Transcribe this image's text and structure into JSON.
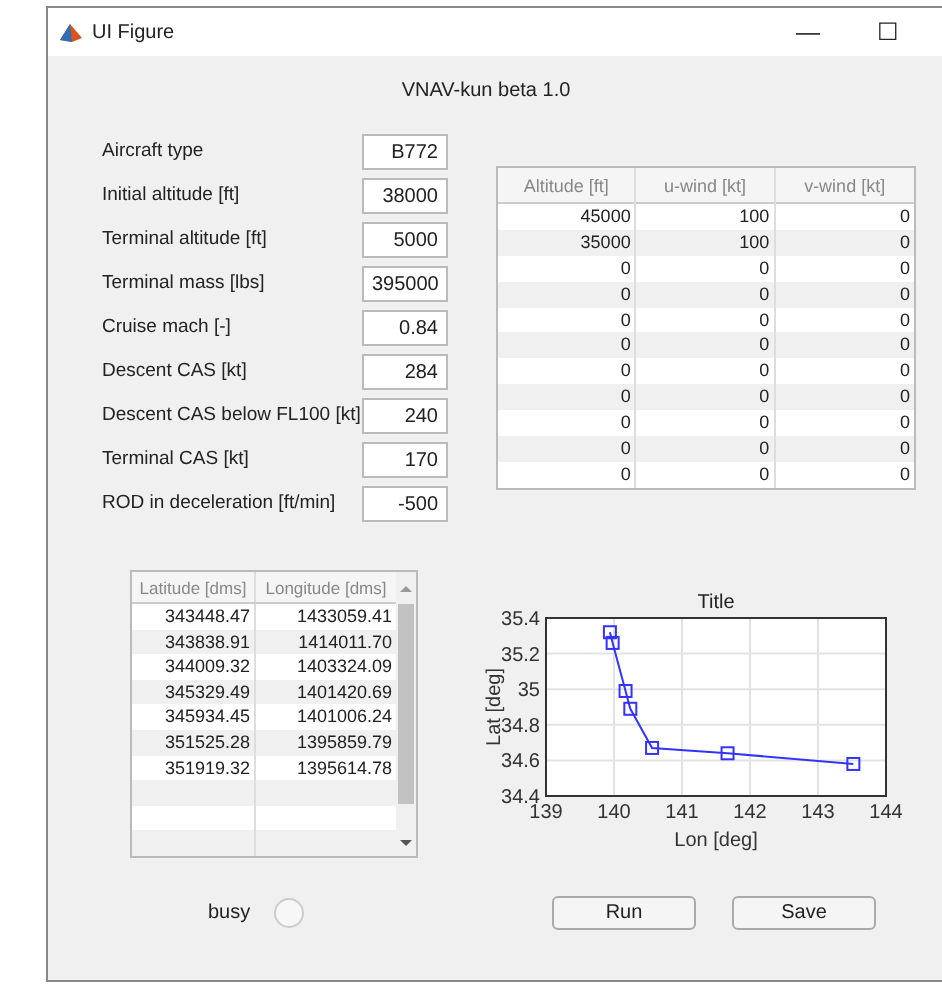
{
  "window": {
    "title": "UI Figure",
    "controls": [
      "—",
      "☐"
    ]
  },
  "header": "VNAV-kun beta 1.0",
  "form": [
    {
      "label": "Aircraft type",
      "value": "B772"
    },
    {
      "label": "Initial altitude [ft]",
      "value": "38000"
    },
    {
      "label": "Terminal altitude [ft]",
      "value": "5000"
    },
    {
      "label": "Terminal mass [lbs]",
      "value": "395000"
    },
    {
      "label": "Cruise mach [-]",
      "value": "0.84"
    },
    {
      "label": "Descent CAS [kt]",
      "value": "284"
    },
    {
      "label": "Descent CAS below FL100 [kt]",
      "value": "240"
    },
    {
      "label": "Terminal CAS [kt]",
      "value": "170"
    },
    {
      "label": "ROD in deceleration [ft/min]",
      "value": "-500"
    }
  ],
  "wind_table": {
    "columns": [
      "Altitude [ft]",
      "u-wind [kt]",
      "v-wind [kt]"
    ],
    "rows": [
      [
        "45000",
        "100",
        "0"
      ],
      [
        "35000",
        "100",
        "0"
      ],
      [
        "0",
        "0",
        "0"
      ],
      [
        "0",
        "0",
        "0"
      ],
      [
        "0",
        "0",
        "0"
      ],
      [
        "0",
        "0",
        "0"
      ],
      [
        "0",
        "0",
        "0"
      ],
      [
        "0",
        "0",
        "0"
      ],
      [
        "0",
        "0",
        "0"
      ],
      [
        "0",
        "0",
        "0"
      ],
      [
        "0",
        "0",
        "0"
      ]
    ]
  },
  "waypoint_table": {
    "columns": [
      "Latitude [dms]",
      "Longitude [dms]"
    ],
    "rows": [
      [
        "343448.47",
        "1433059.41"
      ],
      [
        "343838.91",
        "1414011.70"
      ],
      [
        "344009.32",
        "1403324.09"
      ],
      [
        "345329.49",
        "1401420.69"
      ],
      [
        "345934.45",
        "1401006.24"
      ],
      [
        "351525.28",
        "1395859.79"
      ],
      [
        "351919.32",
        "1395614.78"
      ]
    ]
  },
  "busy": {
    "label": "busy",
    "on": false
  },
  "chart": {
    "chart_data": {
      "type": "line",
      "title": "Title",
      "xlabel": "Lon [deg]",
      "ylabel": "Lat [deg]",
      "x": [
        143.52,
        141.67,
        140.56,
        140.24,
        140.17,
        139.98,
        139.94
      ],
      "grid": true,
      "series": [
        {
          "color": "#3333ff",
          "marker": "square",
          "values": [
            34.58,
            34.64,
            34.67,
            34.89,
            34.99,
            35.26,
            35.32
          ]
        }
      ],
      "xlim": [
        139,
        144
      ],
      "ylim": [
        34.4,
        35.4
      ],
      "xticks": [
        139,
        140,
        141,
        142,
        143,
        144
      ],
      "yticks": [
        {
          "value": 34.4,
          "label": "34.4"
        },
        {
          "value": 34.6,
          "label": "34.6"
        },
        {
          "value": 34.8,
          "label": "34.8"
        },
        {
          "value": 35,
          "label": "35"
        },
        {
          "value": 35.2,
          "label": "35.2"
        },
        {
          "value": 35.4,
          "label": "35.4"
        }
      ]
    }
  },
  "buttons": [
    "Run",
    "Save"
  ]
}
